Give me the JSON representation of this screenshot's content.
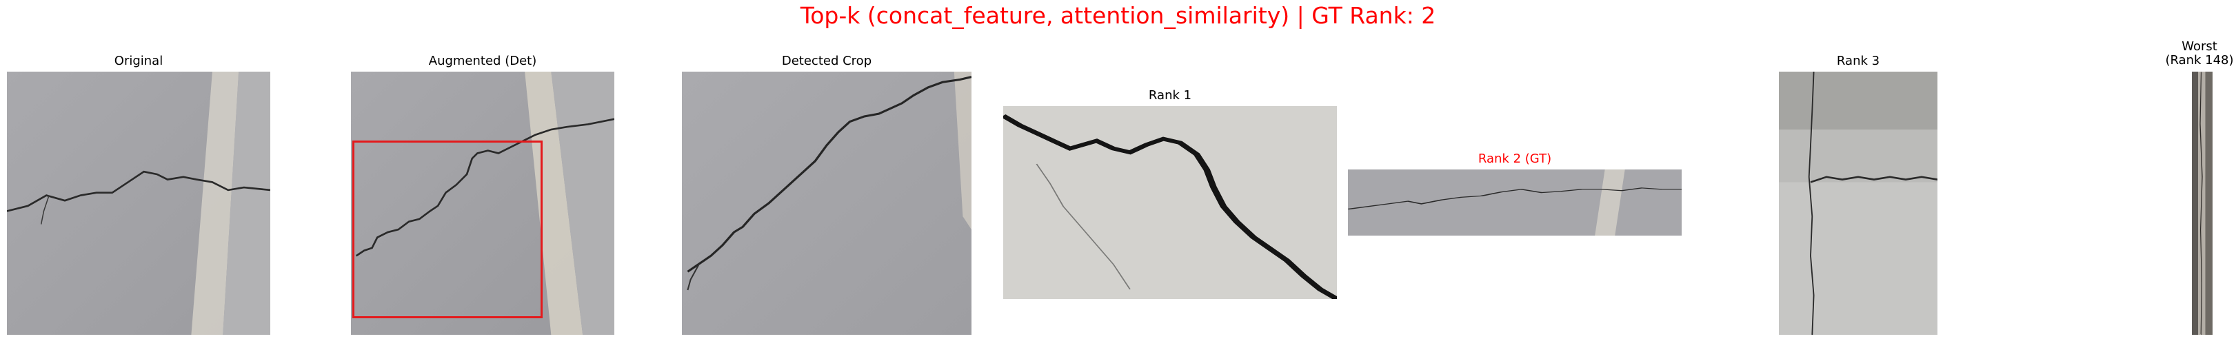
{
  "figure": {
    "title": "Top-k (concat_feature, attention_similarity) | GT Rank: 2",
    "title_color": "#ff0000"
  },
  "panels": [
    {
      "title": "Original",
      "image": "concrete-crack-photo"
    },
    {
      "title": "Augmented (Det)",
      "image": "concrete-crack-photo-with-detection-box",
      "box_color": "#e41a1c"
    },
    {
      "title": "Detected Crop",
      "image": "cropped-concrete-crack-photo"
    },
    {
      "title": "Rank 1",
      "image": "wall-crack-photo"
    },
    {
      "title": "Rank 2 (GT)",
      "image": "wide-concrete-crack-photo",
      "title_color": "#ff0000"
    },
    {
      "title": "Rank 3",
      "image": "concrete-wall-crack-photo"
    },
    {
      "title_line1": "Worst",
      "title_line2": "(Rank 148)",
      "image": "narrow-textured-strip-photo"
    }
  ]
}
